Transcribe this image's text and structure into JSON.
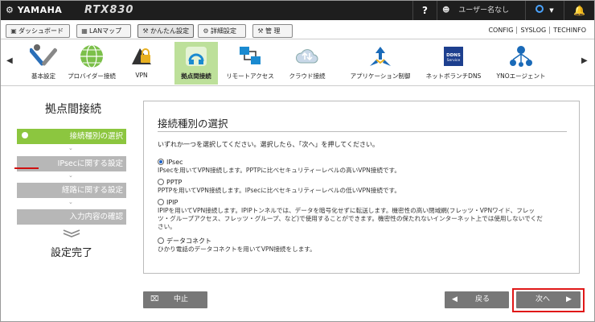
{
  "topbar": {
    "brand": "YAMAHA",
    "model": "RTX830",
    "help": "?",
    "user": "ユーザー名なし",
    "status_icon": "ring-indicator-icon",
    "bell_icon": "bell-icon"
  },
  "nav": {
    "dashboard": "ダッシュボード",
    "lanmap": "LANマップ",
    "easy": "かんたん設定",
    "detail": "詳細設定",
    "manage": "管 理",
    "links": [
      "CONFIG",
      "SYSLOG",
      "TECHINFO"
    ]
  },
  "tools": {
    "basic": "基本設定",
    "provider": "プロバイダー接続",
    "vpn": "VPN",
    "site": "拠点間接続",
    "remote": "リモートアクセス",
    "cloud": "クラウド接続",
    "app": "アプリケーション制御",
    "netvol": "ネットボランチDNS",
    "yno": "YNOエージェント",
    "ddns_text": "DDNS Service"
  },
  "steps": {
    "title": "拠点間接続",
    "items": [
      "接続種別の選択",
      "IPsecに関する設定",
      "経路に関する設定",
      "入力内容の確認"
    ],
    "done": "設定完了"
  },
  "panel": {
    "title": "接続種別の選択",
    "instruction": "いずれか一つを選択してください。選択したら、「次へ」を押してください。",
    "options": [
      {
        "label": "IPsec",
        "desc": [
          "IPsecを用いてVPN接続します。PPTPに比べセキュリティーレベルの高いVPN接続です。"
        ]
      },
      {
        "label": "PPTP",
        "desc": [
          "PPTPを用いてVPN接続します。IPsecに比べセキュリティーレベルの低いVPN接続です。"
        ]
      },
      {
        "label": "IPIP",
        "desc": [
          "IPIPを用いてVPN接続します。IPIPトンネルでは、データを暗号化せずに転送します。機密性の高い閉域網(フレッツ・VPNワイド、フレッ",
          "ツ・グループアクセス、フレッツ・グループ、など)で使用することができます。機密性の保たれないインターネット上では使用しないでくだ",
          "さい。"
        ]
      },
      {
        "label": "データコネクト",
        "desc": [
          "ひかり電話のデータコネクトを用いてVPN接続をします。"
        ]
      }
    ]
  },
  "buttons": {
    "cancel": "中止",
    "back": "戻る",
    "next": "次へ"
  }
}
